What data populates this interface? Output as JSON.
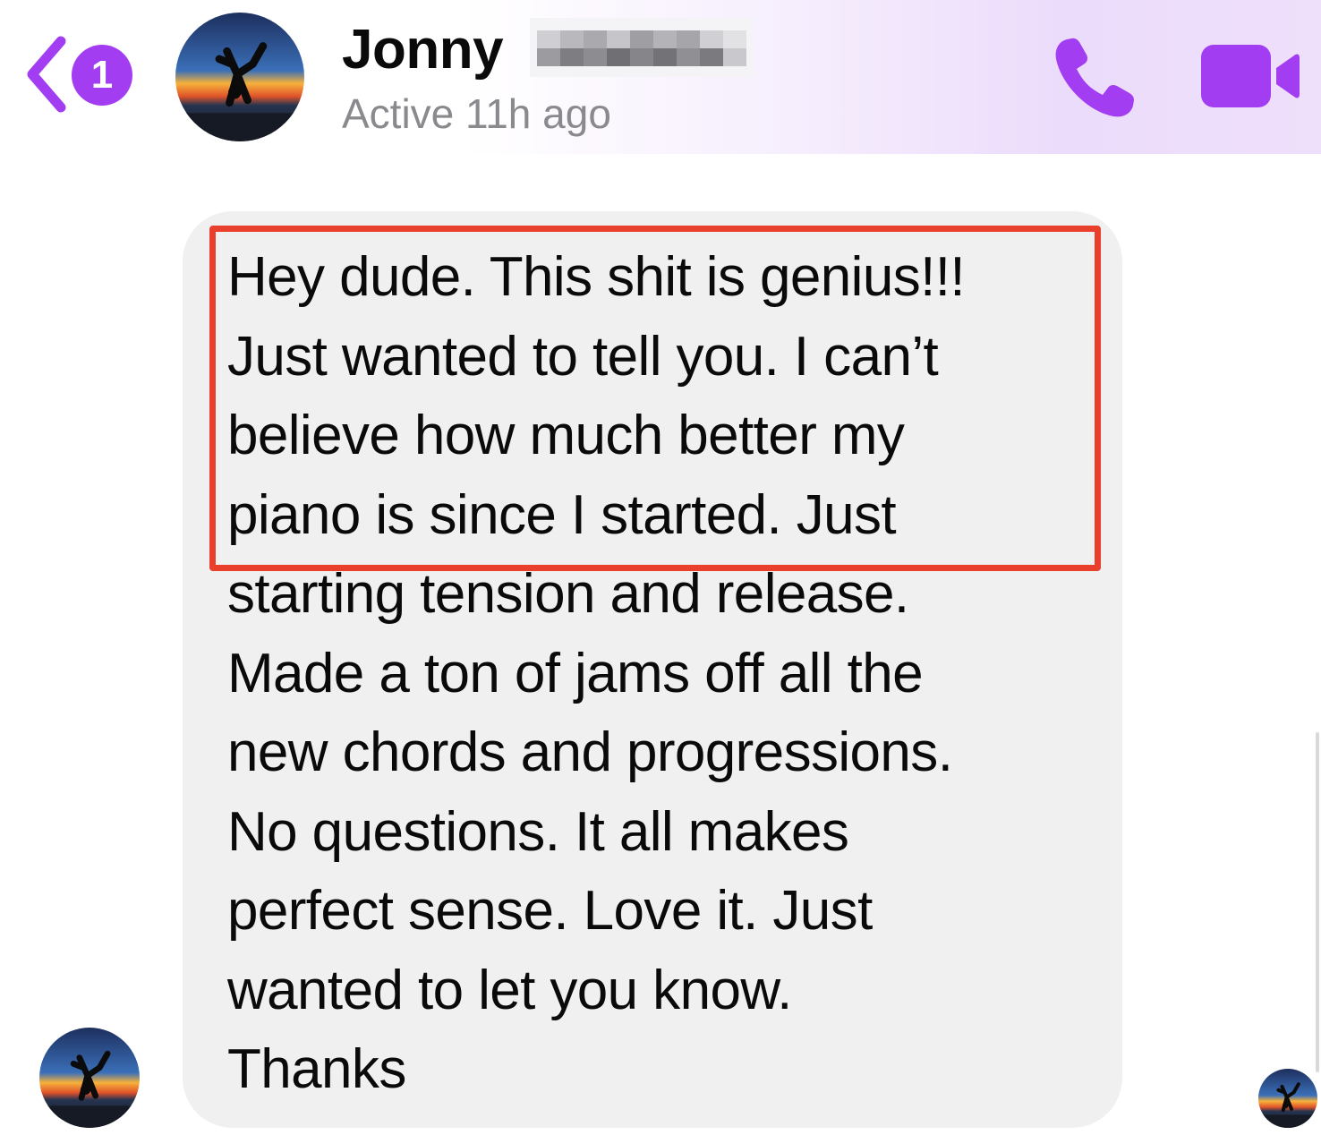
{
  "header": {
    "back_badge_count": "1",
    "contact_name": "Jonny",
    "active_status": "Active 11h ago",
    "back_icon": "chevron-left-icon",
    "call_icon": "phone-icon",
    "video_icon": "video-camera-icon"
  },
  "conversation": {
    "message_text": "Hey dude. This shit is genius!!!\nJust wanted to tell you. I can’t\nbelieve how much better my\npiano is since I started. Just\nstarting tension and release.\nMade a ton of jams off all the\nnew chords and progressions.\nNo questions. It all makes\nperfect sense. Love it. Just\nwanted to let you know.\nThanks"
  },
  "colors": {
    "accent": "#a23df2",
    "highlight": "#e8402c",
    "bubble": "#f0f0f0",
    "secondary_text": "#8a8a8e"
  }
}
